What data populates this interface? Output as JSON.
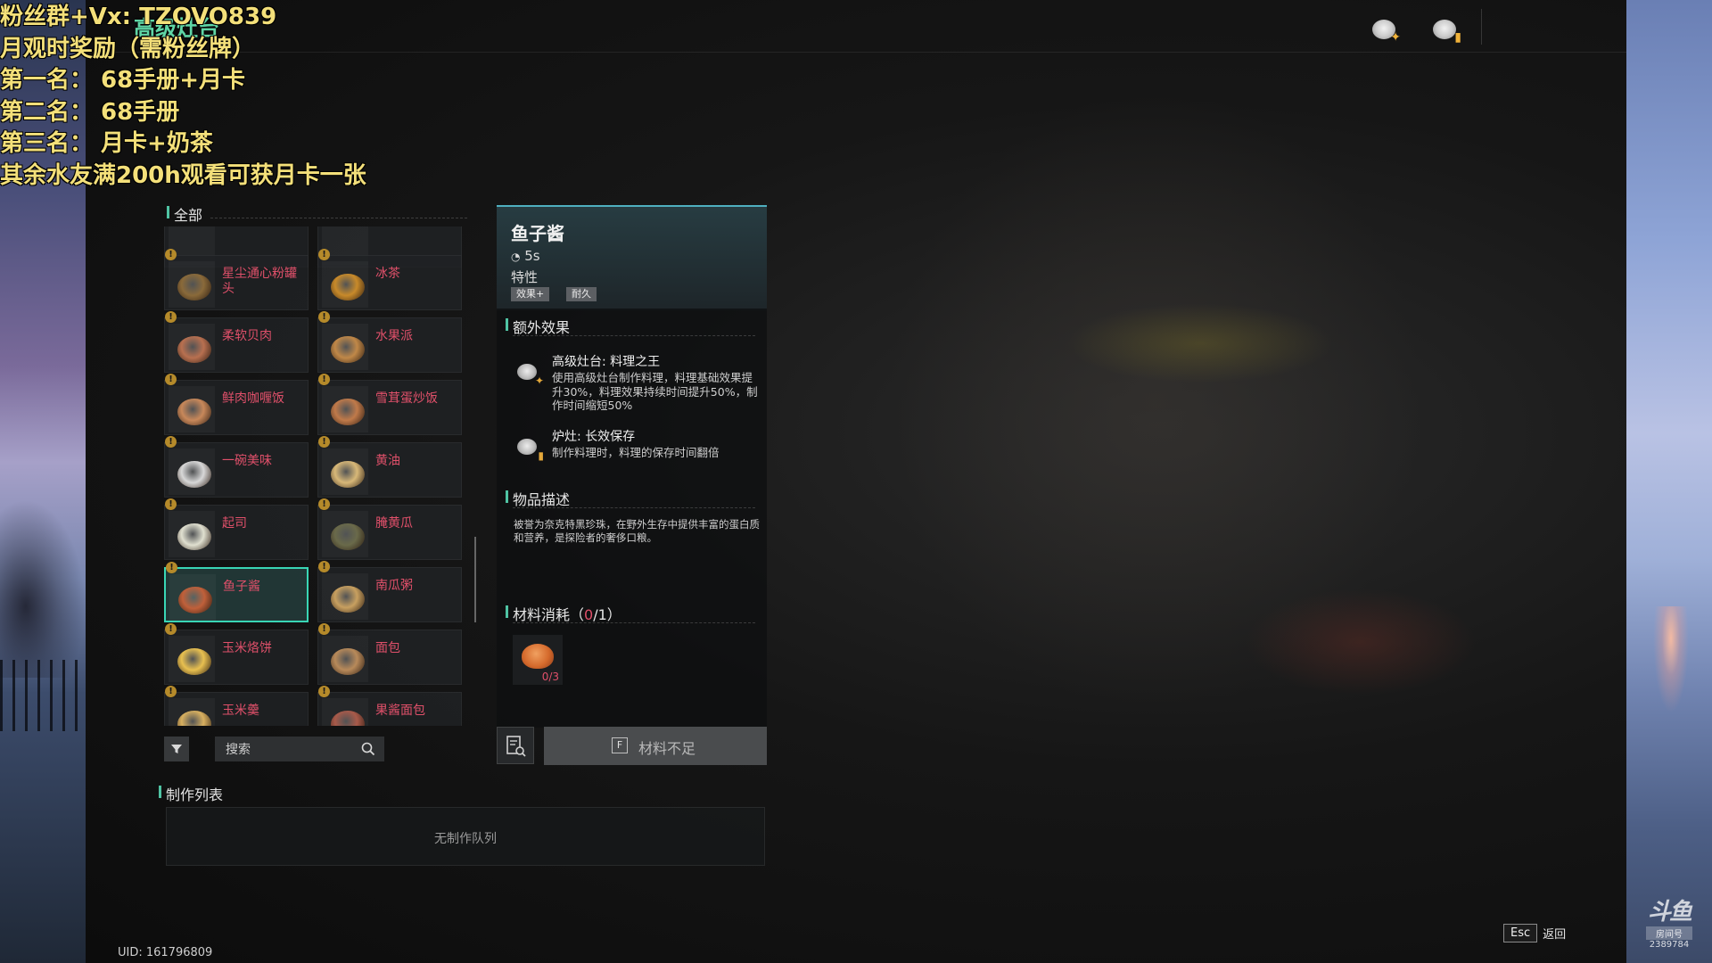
{
  "stream_overlay": {
    "lines": [
      "粉丝群+Vx: TZOVO839",
      "月观时奖励（需粉丝牌）",
      "第一名：  68手册+月卡",
      "第二名：  68手册",
      "第三名：  月卡+奶茶",
      "其余水友满200h观看可获月卡一张"
    ]
  },
  "header": {
    "stove_title": "高级灶台",
    "icons": [
      "master-chef-stove-icon",
      "long-lasting-stove-icon"
    ]
  },
  "category": {
    "label": "全部"
  },
  "recipes": [
    {
      "name": "星尘通心粉罐头",
      "color": "#8a6a3a"
    },
    {
      "name": "冰茶",
      "color": "#c88a2a"
    },
    {
      "name": "柔软贝肉",
      "color": "#b87050"
    },
    {
      "name": "水果派",
      "color": "#c08848"
    },
    {
      "name": "鲜肉咖喱饭",
      "color": "#c8885a"
    },
    {
      "name": "雪茸蛋炒饭",
      "color": "#c07a4a"
    },
    {
      "name": "一碗美味",
      "color": "#d8d8d8"
    },
    {
      "name": "黄油",
      "color": "#d8b878"
    },
    {
      "name": "起司",
      "color": "#e0e0d0"
    },
    {
      "name": "腌黄瓜",
      "color": "#6a6a4a"
    },
    {
      "name": "鱼子酱",
      "color": "#c0603a"
    },
    {
      "name": "南瓜粥",
      "color": "#c8a060"
    },
    {
      "name": "玉米烙饼",
      "color": "#e8c050"
    },
    {
      "name": "面包",
      "color": "#b88a5a"
    },
    {
      "name": "玉米羹",
      "color": "#d8b060"
    },
    {
      "name": "果酱面包",
      "color": "#a85a4a"
    }
  ],
  "selected_recipe": "鱼子酱",
  "search": {
    "placeholder": "搜索"
  },
  "queue": {
    "title": "制作列表",
    "empty_text": "无制作队列"
  },
  "detail": {
    "title": "鱼子酱",
    "time": "5s",
    "traits_label": "特性",
    "tags": [
      "效果+",
      "耐久"
    ],
    "extra_effects_title": "额外效果",
    "effects": [
      {
        "title": "高级灶台: 料理之王",
        "desc": "使用高级灶台制作料理，料理基础效果提升30%，料理效果持续时间提升50%，制作时间缩短50%",
        "icon": "master-chef-stove-icon"
      },
      {
        "title": "炉灶: 长效保存",
        "desc": "制作料理时，料理的保存时间翻倍",
        "icon": "long-lasting-stove-icon"
      }
    ],
    "desc_title": "物品描述",
    "desc": "被誉为奈克特黑珍珠，在野外生存中提供丰富的蛋白质和营养，是探险者的奢侈口粮。",
    "materials_title_prefix": "材料消耗（",
    "materials_have": "0",
    "materials_title_suffix": "/1）",
    "material_count": "0/3",
    "craft_key": "F",
    "craft_label": "材料不足"
  },
  "footer": {
    "uid": "UID: 161796809",
    "esc_key": "Esc",
    "esc_label": "返回"
  },
  "watermark": {
    "logo": "斗鱼",
    "room_label": "房间号",
    "room_number": "2389784"
  },
  "colors": {
    "accent": "#4fc3a3",
    "selected_border": "#39d6b5",
    "insufficient_text": "#e0506a",
    "overlay_text": "#f4e07a"
  }
}
